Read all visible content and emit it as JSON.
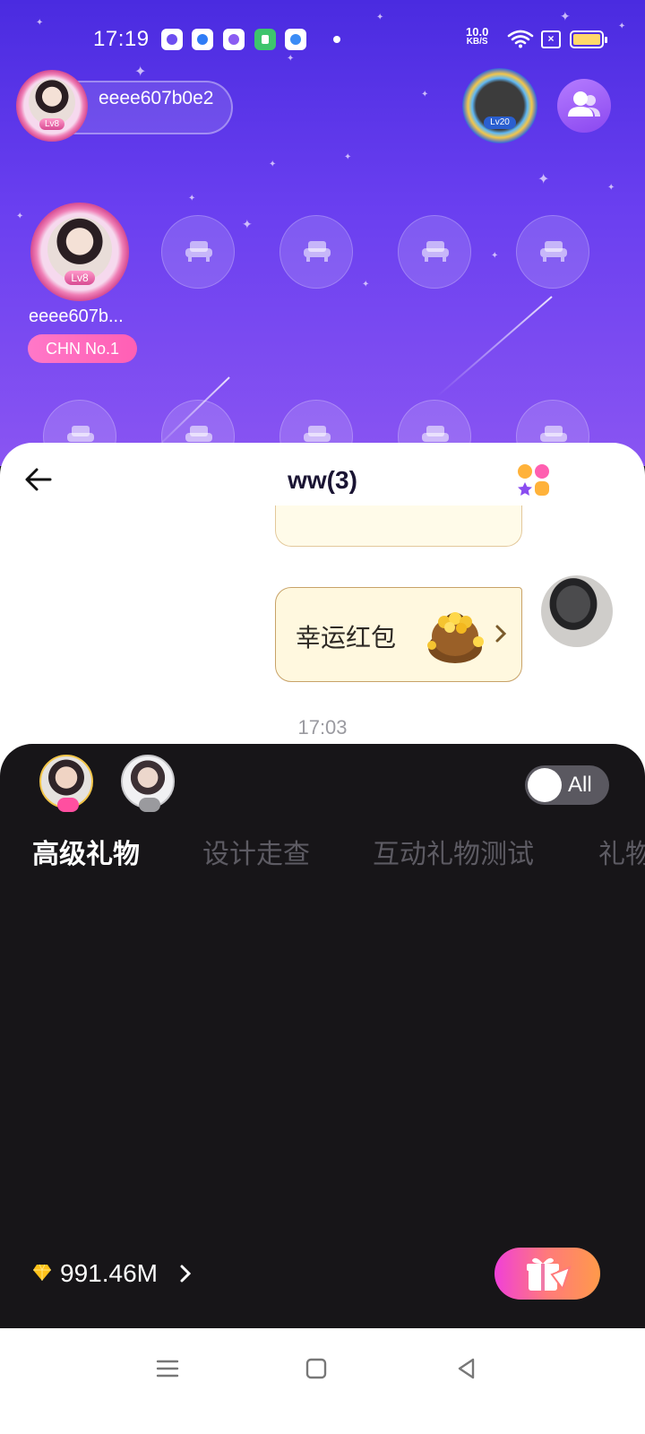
{
  "status_bar": {
    "time": "17:19",
    "net_speed_value": "10.0",
    "net_speed_unit": "KB/S",
    "icons": [
      "app-notification-icon",
      "app-notification-icon",
      "app-notification-icon",
      "app-notification-icon",
      "app-notification-icon",
      "wifi-icon",
      "sim-icon",
      "battery-icon"
    ]
  },
  "room": {
    "host_name": "eeee607b0e2",
    "host_level": "Lv8",
    "top_user_level": "Lv20",
    "seat_host_name": "eeee607b...",
    "seat_host_level": "Lv8",
    "seat_host_rank": "CHN No.1",
    "empty_seat_icon": "sofa-icon"
  },
  "chat": {
    "title": "ww(3)",
    "red_packet_label": "幸运红包",
    "timestamp": "17:03"
  },
  "gift_panel": {
    "all_toggle_label": "All",
    "tabs": [
      {
        "label": "高级礼物",
        "active": true
      },
      {
        "label": "设计走查",
        "active": false
      },
      {
        "label": "互动礼物测试",
        "active": false
      },
      {
        "label": "礼物",
        "active": false
      }
    ],
    "balance": "991.46M",
    "colors": {
      "accent": "#f040d8",
      "background": "#171518"
    }
  },
  "nav_bar": {
    "icons": [
      "menu-icon",
      "home-square-icon",
      "back-triangle-icon"
    ]
  }
}
